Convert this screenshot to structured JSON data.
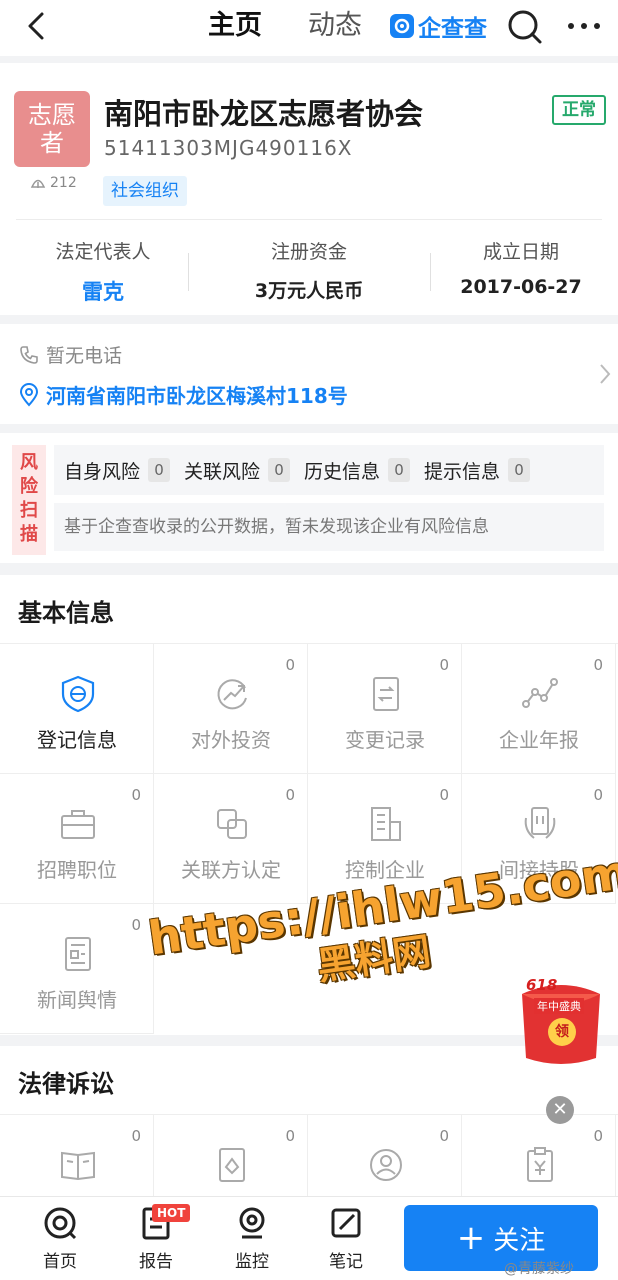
{
  "nav": {
    "tab_home": "主页",
    "tab_dynamic": "动态",
    "brand_name": "企查查",
    "back_icon": "back-arrow-icon",
    "search_icon": "search-icon",
    "more_icon": "more-dots-icon"
  },
  "company": {
    "avatar_text_1": "志愿",
    "avatar_text_2": "者",
    "views": "212",
    "name": "南阳市卧龙区志愿者协会",
    "credit_code": "51411303MJG490116X",
    "tag": "社会组织",
    "status": "正常",
    "legal_rep_label": "法定代表人",
    "legal_rep": "雷克",
    "capital_label": "注册资金",
    "capital": "3万元人民币",
    "founded_label": "成立日期",
    "founded": "2017-06-27"
  },
  "contact": {
    "phone": "暂无电话",
    "address": "河南省南阳市卧龙区梅溪村118号"
  },
  "risk": {
    "label": "风险扫描",
    "label_chars": [
      "风",
      "险",
      "扫",
      "描"
    ],
    "items": [
      {
        "label": "自身风险",
        "count": "0"
      },
      {
        "label": "关联风险",
        "count": "0"
      },
      {
        "label": "历史信息",
        "count": "0"
      },
      {
        "label": "提示信息",
        "count": "0"
      }
    ],
    "note": "基于企查查收录的公开数据，暂未发现该企业有风险信息"
  },
  "basic": {
    "title": "基本信息",
    "items": [
      {
        "label": "登记信息",
        "count": "",
        "icon": "registration-shield-icon"
      },
      {
        "label": "对外投资",
        "count": "0",
        "icon": "investment-icon"
      },
      {
        "label": "变更记录",
        "count": "0",
        "icon": "change-record-icon"
      },
      {
        "label": "企业年报",
        "count": "0",
        "icon": "annual-report-chart-icon"
      },
      {
        "label": "招聘职位",
        "count": "0",
        "icon": "briefcase-icon"
      },
      {
        "label": "关联方认定",
        "count": "0",
        "icon": "related-party-icon"
      },
      {
        "label": "控制企业",
        "count": "0",
        "icon": "building-icon"
      },
      {
        "label": "间接持股",
        "count": "0",
        "icon": "indirect-holding-icon"
      },
      {
        "label": "新闻舆情",
        "count": "0",
        "icon": "news-icon"
      }
    ]
  },
  "legal": {
    "title": "法律诉讼",
    "items": [
      {
        "count": "0",
        "icon": "law-book-icon"
      },
      {
        "count": "0",
        "icon": "case-file-icon"
      },
      {
        "count": "0",
        "icon": "person-target-icon"
      },
      {
        "count": "0",
        "icon": "clipboard-yen-icon"
      }
    ]
  },
  "bottom": {
    "home": "首页",
    "report": "报告",
    "report_badge": "HOT",
    "monitor": "监控",
    "notes": "笔记",
    "follow": "关注"
  },
  "overlay": {
    "watermark_line1": "https://ihlw15.com",
    "watermark_line2": "黑料网",
    "promo_title": "618",
    "promo_tag": "年中盛典",
    "promo_button": "领",
    "close_label": "✕",
    "weibo": "@青藤紫纱"
  },
  "colors": {
    "brand_blue": "#1682f4",
    "status_green": "#26a96c",
    "risk_red": "#e04848",
    "avatar_pink": "#e88e8e"
  }
}
